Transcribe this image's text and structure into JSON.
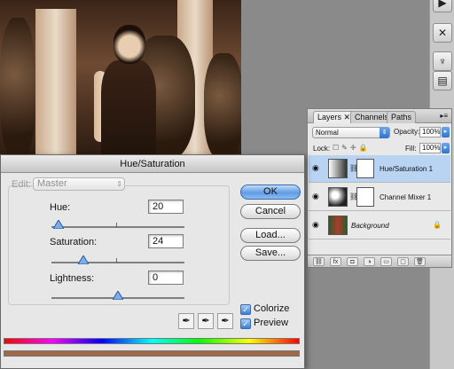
{
  "dialog": {
    "title": "Hue/Saturation",
    "edit_label": "Edit:",
    "edit_value": "Master",
    "params": [
      {
        "label": "Hue:",
        "value": "20",
        "fraction": 0.055
      },
      {
        "label": "Saturation:",
        "value": "24",
        "fraction": 0.24
      },
      {
        "label": "Lightness:",
        "value": "0",
        "fraction": 0.5
      }
    ],
    "buttons": {
      "ok": "OK",
      "cancel": "Cancel",
      "load": "Load...",
      "save": "Save..."
    },
    "colorize_label": "Colorize",
    "preview_label": "Preview",
    "colorize_checked": true,
    "preview_checked": true,
    "result_color": "#a06a48"
  },
  "layers_panel": {
    "tabs": [
      "Layers",
      "Channels",
      "Paths"
    ],
    "blend_mode": "Normal",
    "opacity_label": "Opacity:",
    "opacity_value": "100%",
    "lock_label": "Lock:",
    "fill_label": "Fill:",
    "fill_value": "100%",
    "layers": [
      {
        "name": "Hue/Saturation 1",
        "selected": true
      },
      {
        "name": "Channel Mixer 1",
        "selected": false
      },
      {
        "name": "Background",
        "selected": false
      }
    ]
  }
}
